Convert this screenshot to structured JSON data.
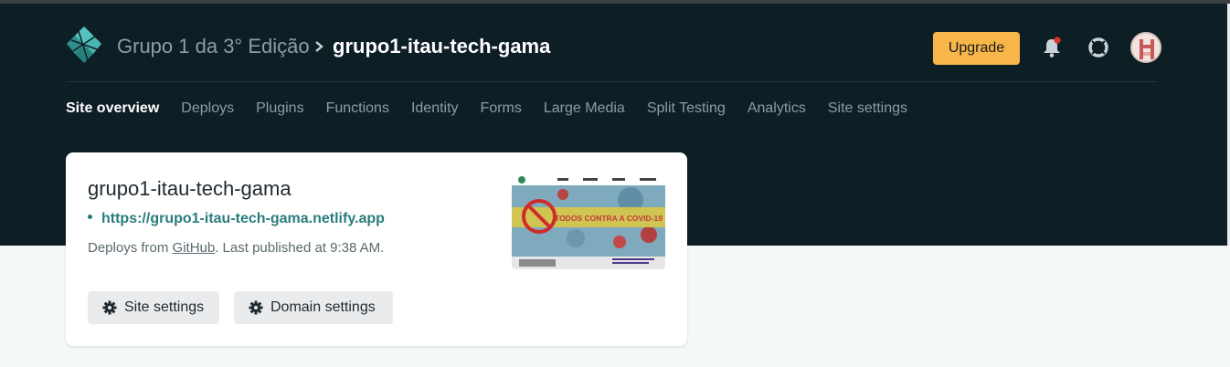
{
  "header": {
    "team_name": "Grupo 1 da 3° Edição",
    "site_name": "grupo1-itau-tech-gama",
    "upgrade_label": "Upgrade",
    "colors": {
      "background": "#0e1e25",
      "accent": "#f7b54a",
      "notification_dot": "#e03131"
    }
  },
  "nav": {
    "items": [
      {
        "label": "Site overview",
        "active": true
      },
      {
        "label": "Deploys"
      },
      {
        "label": "Plugins"
      },
      {
        "label": "Functions"
      },
      {
        "label": "Identity"
      },
      {
        "label": "Forms"
      },
      {
        "label": "Large Media"
      },
      {
        "label": "Split Testing"
      },
      {
        "label": "Analytics"
      },
      {
        "label": "Site settings"
      }
    ]
  },
  "card": {
    "title": "grupo1-itau-tech-gama",
    "url": "https://grupo1-itau-tech-gama.netlify.app",
    "deploy_prefix": "Deploys from ",
    "deploy_provider": "GitHub",
    "deploy_suffix": ". Last published at 9:38 AM.",
    "buttons": {
      "site_settings": "Site settings",
      "domain_settings": "Domain settings"
    },
    "thumbnail_banner": "TODOS CONTRA A COVID-19"
  },
  "icons": {
    "logo": "netlify-logo-icon",
    "separator": "chevron-right-icon",
    "bell": "bell-icon",
    "help": "help-lifebuoy-icon",
    "gear": "gear-icon"
  }
}
